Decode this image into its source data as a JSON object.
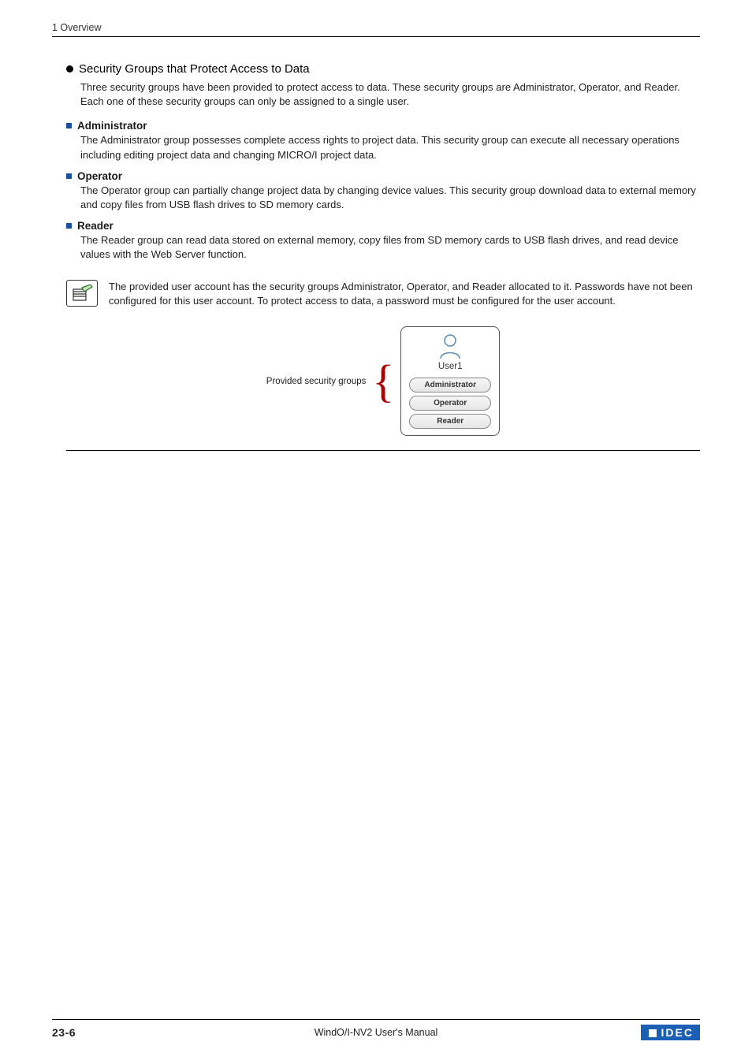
{
  "header": {
    "running": "1 Overview"
  },
  "section": {
    "title": "Security Groups that Protect Access to Data",
    "intro": "Three security groups have been provided to protect access to data. These security groups are Administrator, Operator, and Reader. Each one of these security groups can only be assigned to a single user."
  },
  "groups": [
    {
      "name": "Administrator",
      "desc": "The Administrator group possesses complete access rights to project data. This security group can execute all necessary operations including editing project data and changing MICRO/I project data."
    },
    {
      "name": "Operator",
      "desc": "The Operator group can partially change project data by changing device values. This security group download data to external memory and copy files from USB flash drives to SD memory cards."
    },
    {
      "name": "Reader",
      "desc": "The Reader group can read data stored on external memory, copy files from SD memory cards to USB flash drives, and read device values with the Web Server function."
    }
  ],
  "note": "The provided user account has the security groups Administrator, Operator, and Reader allocated to it. Passwords have not been configured for this user account. To protect access to data, a password must be configured for the user account.",
  "diagram": {
    "provided_label": "Provided security groups",
    "user": "User1",
    "chips": [
      "Administrator",
      "Operator",
      "Reader"
    ]
  },
  "footer": {
    "page": "23-6",
    "manual": "WindO/I-NV2 User's Manual",
    "brand": "IDEC"
  }
}
